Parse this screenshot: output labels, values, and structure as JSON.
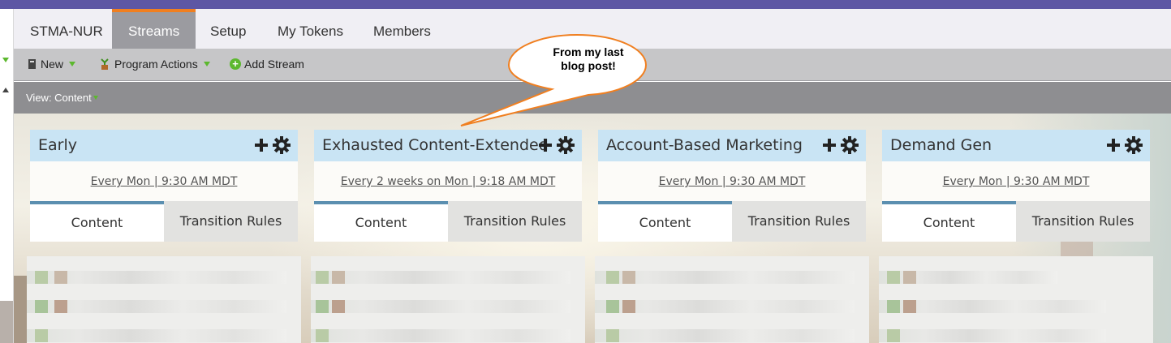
{
  "nav": {
    "tabs": [
      {
        "label": "STMA-NUR",
        "active": false
      },
      {
        "label": "Streams",
        "active": true
      },
      {
        "label": "Setup",
        "active": false
      },
      {
        "label": "My Tokens",
        "active": false
      },
      {
        "label": "Members",
        "active": false
      }
    ]
  },
  "toolbar": {
    "new_label": "New",
    "program_actions_label": "Program Actions",
    "add_stream_label": "Add Stream"
  },
  "view": {
    "label": "View: Content"
  },
  "callout": {
    "line1": "From my last",
    "line2": "blog post!"
  },
  "streams": [
    {
      "title": "Early",
      "schedule": "Every Mon | 9:30 AM MDT",
      "tab_content": "Content",
      "tab_rules": "Transition Rules"
    },
    {
      "title": "Exhausted Content-Extended",
      "schedule": "Every 2 weeks on Mon | 9:18 AM MDT",
      "tab_content": "Content",
      "tab_rules": "Transition Rules"
    },
    {
      "title": "Account-Based Marketing",
      "schedule": "Every Mon | 9:30 AM MDT",
      "tab_content": "Content",
      "tab_rules": "Transition Rules"
    },
    {
      "title": "Demand Gen",
      "schedule": "Every Mon | 9:30 AM MDT",
      "tab_content": "Content",
      "tab_rules": "Transition Rules"
    }
  ],
  "colors": {
    "brand_bar": "#5d57a4",
    "active_tab_accent": "#f07f20",
    "stream_header": "#c9e4f4",
    "callout_border": "#f07f20"
  }
}
